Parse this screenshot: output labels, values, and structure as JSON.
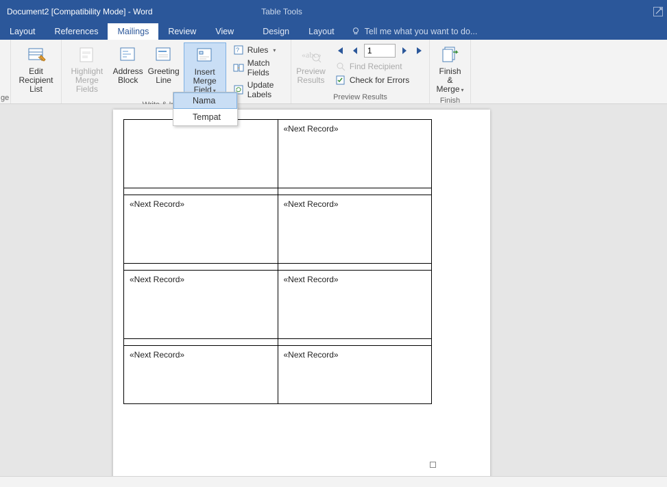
{
  "title": "Document2 [Compatibility Mode] - Word",
  "context_tab": "Table Tools",
  "tabs": [
    "Layout",
    "References",
    "Mailings",
    "Review",
    "View",
    "Design",
    "Layout"
  ],
  "active_tab": "Mailings",
  "tellme": "Tell me what you want to do...",
  "ribbon": {
    "trunc_label": "ge",
    "edit_recipient": "Edit\nRecipient List",
    "highlight_fields": "Highlight\nMerge Fields",
    "address_block": "Address\nBlock",
    "greeting_line": "Greeting\nLine",
    "insert_merge_field": "Insert Merge\nField",
    "rules": "Rules",
    "match_fields": "Match Fields",
    "update_labels": "Update Labels",
    "write_insert_label": "Write & Insert Fields",
    "preview_results": "Preview\nResults",
    "record_value": "1",
    "find_recipient": "Find Recipient",
    "check_errors": "Check for Errors",
    "preview_group_label": "Preview Results",
    "finish_merge": "Finish &\nMerge",
    "finish_label": "Finish"
  },
  "menu": {
    "items": [
      "Nama",
      "Tempat"
    ]
  },
  "labels": {
    "next_record": "«Next Record»"
  }
}
